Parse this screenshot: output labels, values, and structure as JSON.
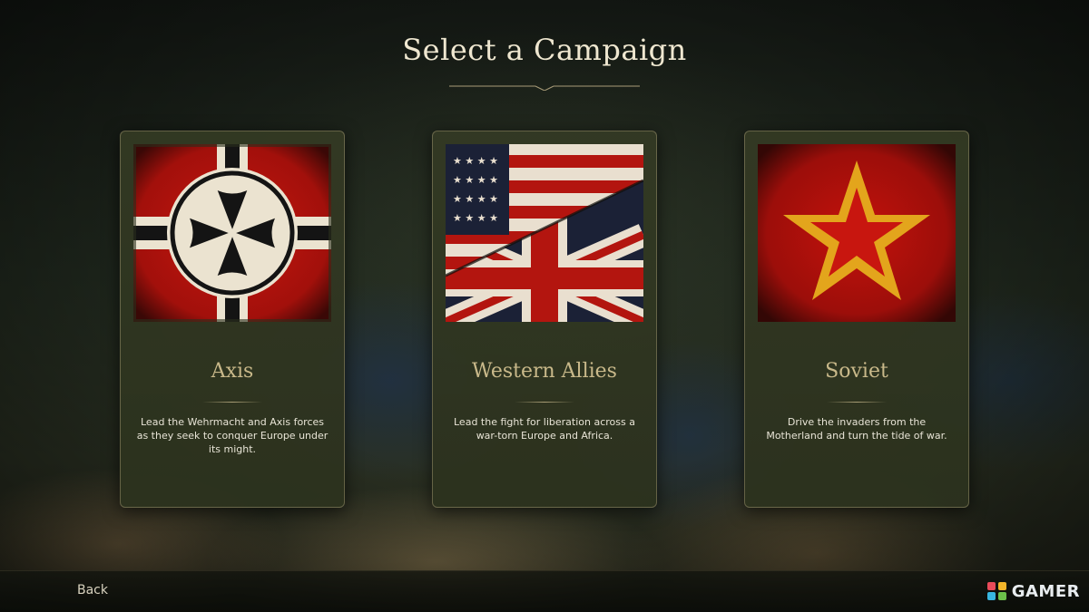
{
  "page": {
    "title": "Select a Campaign"
  },
  "campaigns": [
    {
      "name": "Axis",
      "description": "Lead the Wehrmacht and Axis forces as they seek to conquer Europe under its might.",
      "flag_icon": "iron-cross-flag-icon"
    },
    {
      "name": "Western Allies",
      "description": "Lead the fight for liberation across a war-torn Europe and Africa.",
      "flag_icon": "us-uk-flag-icon"
    },
    {
      "name": "Soviet",
      "description": "Drive the invaders from the Motherland and turn the tide of war.",
      "flag_icon": "soviet-star-flag-icon"
    }
  ],
  "footer": {
    "back_label": "Back"
  },
  "watermark": {
    "text": "GAMER"
  },
  "colors": {
    "title": "#efe7d0",
    "card_name": "#c9b98a",
    "card_bg": "#34391f",
    "flag_red": "#b3140f"
  }
}
